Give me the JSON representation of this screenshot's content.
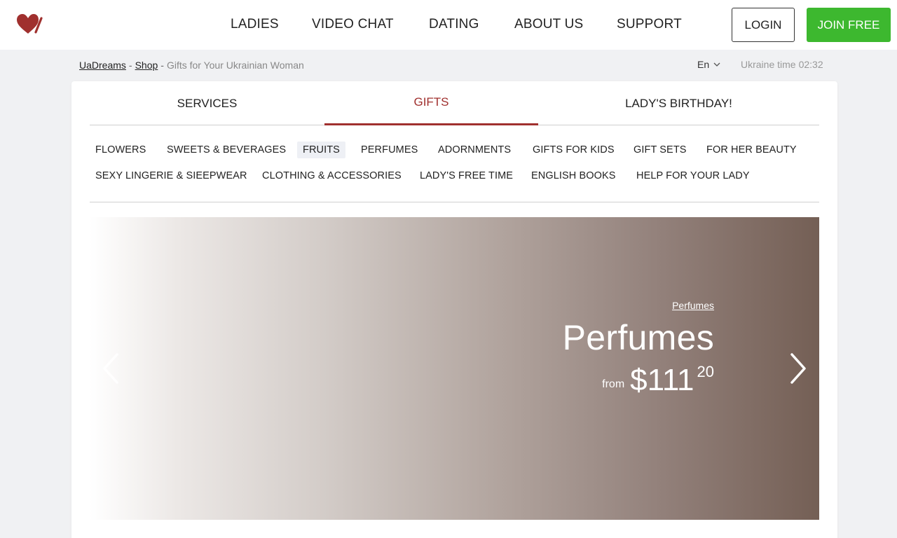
{
  "header": {
    "nav": [
      "LADIES",
      "VIDEO CHAT",
      "DATING",
      "ABOUT US",
      "SUPPORT"
    ],
    "login_label": "LOGIN",
    "join_label": "JOIN FREE",
    "brand_color": "#a0302e",
    "join_color": "#3db82f"
  },
  "breadcrumb": {
    "home": "UaDreams",
    "shop": "Shop",
    "current": "Gifts for Your Ukrainian Woman",
    "separator": "-"
  },
  "topbar": {
    "language": "En",
    "time_label": "Ukraine time",
    "time_value": "02:32"
  },
  "tabs": [
    {
      "label": "SERVICES",
      "active": false
    },
    {
      "label": "GIFTS",
      "active": true
    },
    {
      "label": "LADY'S BIRTHDAY!",
      "active": false
    }
  ],
  "categories": {
    "row1": [
      "FLOWERS",
      "SWEETS & BEVERAGES",
      "FRUITS",
      "PERFUMES",
      "ADORNMENTS",
      "GIFTS FOR KIDS",
      "GIFT SETS",
      "FOR HER BEAUTY"
    ],
    "row2": [
      "SEXY LINGERIE & SIEEPWEAR",
      "CLOTHING & ACCESSORIES",
      "LADY'S FREE TIME",
      "ENGLISH BOOKS",
      "HELP FOR YOUR LADY"
    ],
    "selected": "FRUITS"
  },
  "banner": {
    "link": "Perfumes",
    "title": "Perfumes",
    "from_label": "from",
    "price_whole": "$111",
    "price_cents": "20"
  }
}
